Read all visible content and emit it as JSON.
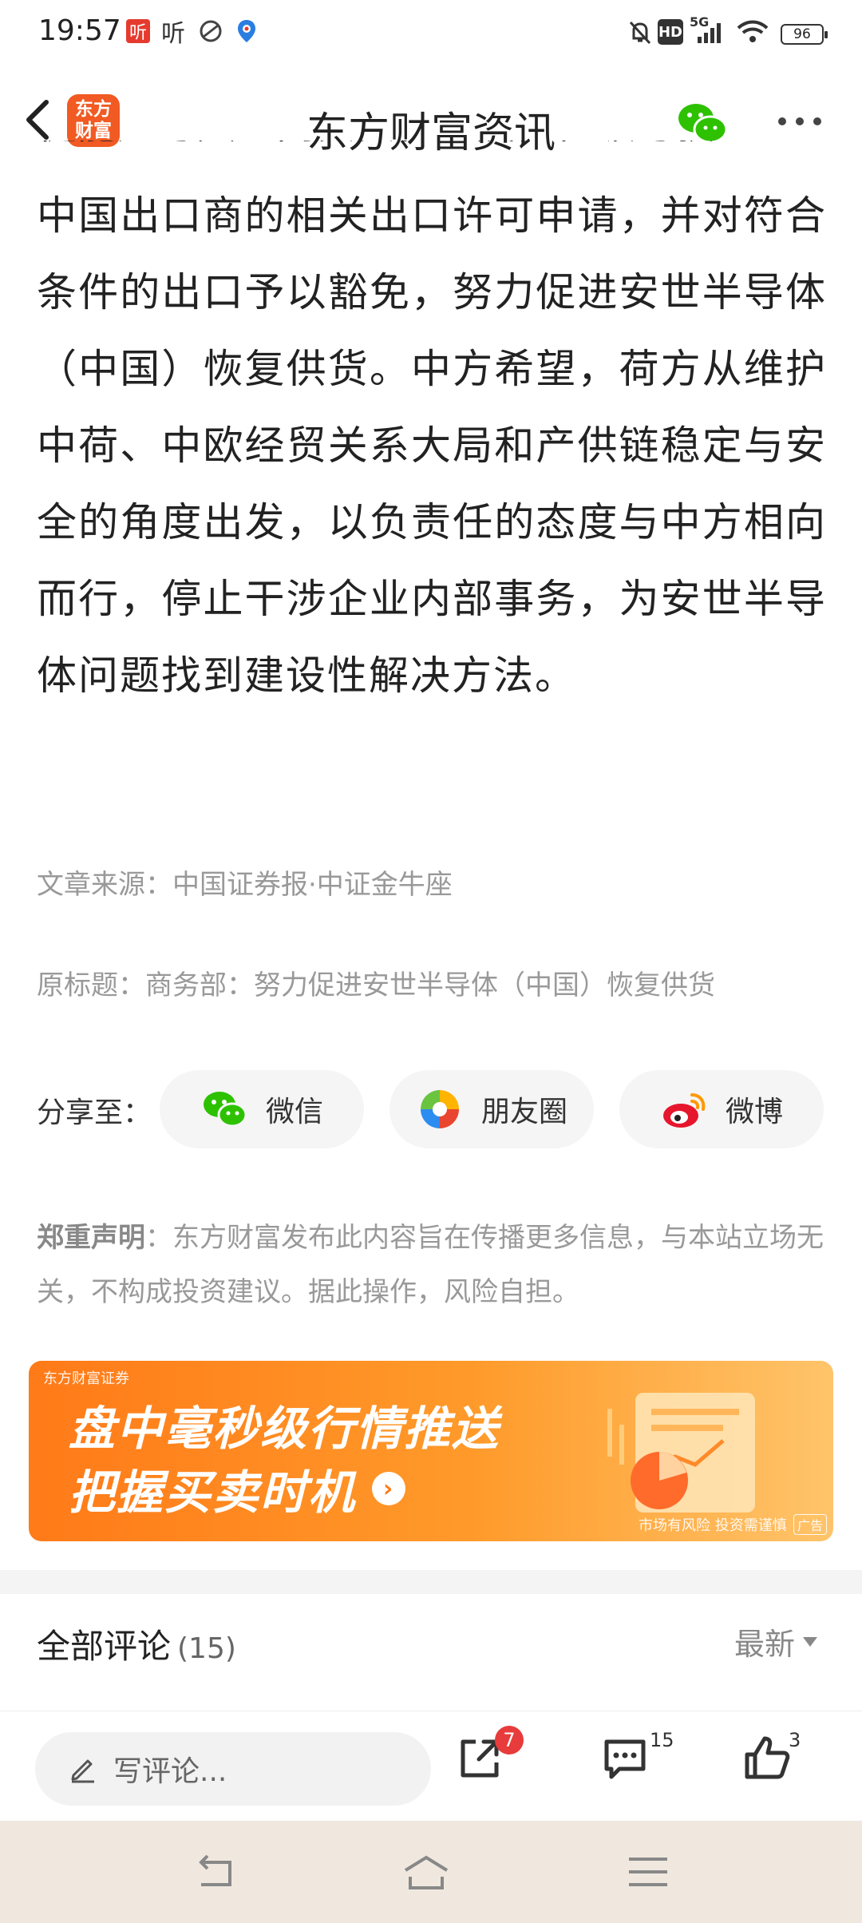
{
  "status_bar": {
    "time": "19:57",
    "app_icon_1": "听",
    "app_icon_2": "听",
    "network": "5G",
    "hd": "HD",
    "battery": "96"
  },
  "navbar": {
    "logo_line1": "东方",
    "logo_line2": "财富",
    "title": "东方财富资讯"
  },
  "article": {
    "cut_line": "徒能是与具全问实实在起展，但领与获",
    "paragraph": "中国出口商的相关出口许可申请，并对符合条件的出口予以豁免，努力促进安世半导体（中国）恢复供货。中方希望，荷方从维护中荷、中欧经贸关系大局和产供链稳定与安全的角度出发，以负责任的态度与中方相向而行，停止干涉企业内部事务，为安世半导体问题找到建设性解决方法。",
    "source": "文章来源：中国证券报·中证金牛座",
    "original_title": "原标题：商务部：努力促进安世半导体（中国）恢复供货"
  },
  "share": {
    "label": "分享至：",
    "wechat": "微信",
    "moments": "朋友圈",
    "weibo": "微博"
  },
  "disclaimer": {
    "title": "郑重声明",
    "text": "：东方财富发布此内容旨在传播更多信息，与本站立场无关，不构成投资建议。据此操作，风险自担。"
  },
  "banner": {
    "brand": "东方财富证券",
    "line1": "盘中毫秒级行情推送",
    "line2": "把握买卖时机",
    "risk": "市场有风险 投资需谨慎",
    "ad": "广告"
  },
  "comments": {
    "title": "全部评论",
    "count": "(15)",
    "sort": "最新"
  },
  "actions": {
    "write_placeholder": "写评论...",
    "share_badge": "7",
    "comment_count": "15",
    "like_count": "3"
  },
  "colors": {
    "brand_orange": "#f15a22",
    "wechat_green": "#2dc100",
    "badge_red": "#e83b3b"
  }
}
